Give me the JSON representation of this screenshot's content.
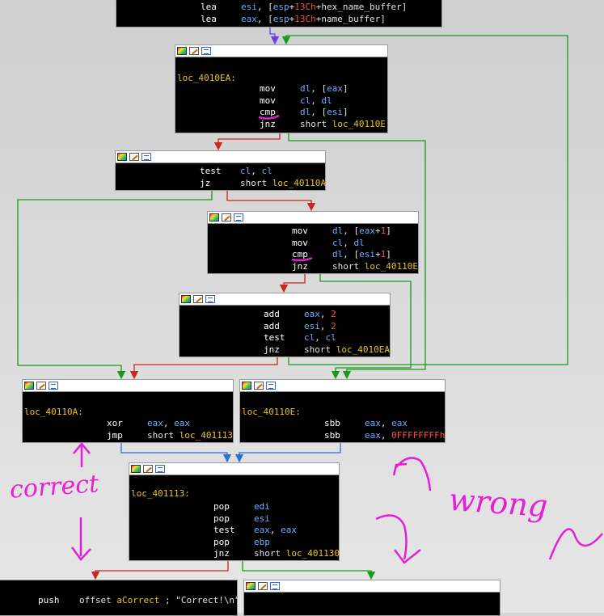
{
  "node0": {
    "lines": [
      {
        "mn": "lea",
        "ops": [
          {
            "t": "esi",
            "c": "reg"
          },
          {
            "t": ", [",
            "c": "tx"
          },
          {
            "t": "esp",
            "c": "reg"
          },
          {
            "t": "+",
            "c": "tx"
          },
          {
            "t": "13Ch",
            "c": "num"
          },
          {
            "t": "+hex_name_buffer]",
            "c": "tx"
          }
        ]
      },
      {
        "mn": "lea",
        "ops": [
          {
            "t": "eax",
            "c": "reg"
          },
          {
            "t": ", [",
            "c": "tx"
          },
          {
            "t": "esp",
            "c": "reg"
          },
          {
            "t": "+",
            "c": "tx"
          },
          {
            "t": "13Ch",
            "c": "num"
          },
          {
            "t": "+name_buffer]",
            "c": "tx"
          }
        ]
      }
    ]
  },
  "node1": {
    "label": "loc_4010EA:",
    "lines": [
      {
        "mn": "mov",
        "ops": [
          {
            "t": "dl",
            "c": "reg"
          },
          {
            "t": ", [",
            "c": "tx"
          },
          {
            "t": "eax",
            "c": "reg"
          },
          {
            "t": "]",
            "c": "tx"
          }
        ]
      },
      {
        "mn": "mov",
        "ops": [
          {
            "t": "cl",
            "c": "reg"
          },
          {
            "t": ", ",
            "c": "tx"
          },
          {
            "t": "dl",
            "c": "reg"
          }
        ]
      },
      {
        "mn": "cmp",
        "ops": [
          {
            "t": "dl",
            "c": "reg"
          },
          {
            "t": ", [",
            "c": "tx"
          },
          {
            "t": "esi",
            "c": "reg"
          },
          {
            "t": "]",
            "c": "tx"
          }
        ]
      },
      {
        "mn": "jnz",
        "ops": [
          {
            "t": "short ",
            "c": "tx"
          },
          {
            "t": "loc_40110E",
            "c": "sym"
          }
        ]
      }
    ]
  },
  "node2": {
    "lines": [
      {
        "mn": "test",
        "ops": [
          {
            "t": "cl",
            "c": "reg"
          },
          {
            "t": ", ",
            "c": "tx"
          },
          {
            "t": "cl",
            "c": "reg"
          }
        ]
      },
      {
        "mn": "jz",
        "ops": [
          {
            "t": "short ",
            "c": "tx"
          },
          {
            "t": "loc_40110A",
            "c": "sym"
          }
        ]
      }
    ]
  },
  "node3": {
    "lines": [
      {
        "mn": "mov",
        "ops": [
          {
            "t": "dl",
            "c": "reg"
          },
          {
            "t": ", [",
            "c": "tx"
          },
          {
            "t": "eax",
            "c": "reg"
          },
          {
            "t": "+",
            "c": "tx"
          },
          {
            "t": "1",
            "c": "num"
          },
          {
            "t": "]",
            "c": "tx"
          }
        ]
      },
      {
        "mn": "mov",
        "ops": [
          {
            "t": "cl",
            "c": "reg"
          },
          {
            "t": ", ",
            "c": "tx"
          },
          {
            "t": "dl",
            "c": "reg"
          }
        ]
      },
      {
        "mn": "cmp",
        "ops": [
          {
            "t": "dl",
            "c": "reg"
          },
          {
            "t": ", [",
            "c": "tx"
          },
          {
            "t": "esi",
            "c": "reg"
          },
          {
            "t": "+",
            "c": "tx"
          },
          {
            "t": "1",
            "c": "num"
          },
          {
            "t": "]",
            "c": "tx"
          }
        ]
      },
      {
        "mn": "jnz",
        "ops": [
          {
            "t": "short ",
            "c": "tx"
          },
          {
            "t": "loc_40110E",
            "c": "sym"
          }
        ]
      }
    ]
  },
  "node4": {
    "lines": [
      {
        "mn": "add",
        "ops": [
          {
            "t": "eax",
            "c": "reg"
          },
          {
            "t": ", ",
            "c": "tx"
          },
          {
            "t": "2",
            "c": "num"
          }
        ]
      },
      {
        "mn": "add",
        "ops": [
          {
            "t": "esi",
            "c": "reg"
          },
          {
            "t": ", ",
            "c": "tx"
          },
          {
            "t": "2",
            "c": "num"
          }
        ]
      },
      {
        "mn": "test",
        "ops": [
          {
            "t": "cl",
            "c": "reg"
          },
          {
            "t": ", ",
            "c": "tx"
          },
          {
            "t": "cl",
            "c": "reg"
          }
        ]
      },
      {
        "mn": "jnz",
        "ops": [
          {
            "t": "short ",
            "c": "tx"
          },
          {
            "t": "loc_4010EA",
            "c": "sym"
          }
        ]
      }
    ]
  },
  "node5": {
    "label": "loc_40110A:",
    "lines": [
      {
        "mn": "xor",
        "ops": [
          {
            "t": "eax",
            "c": "reg"
          },
          {
            "t": ", ",
            "c": "tx"
          },
          {
            "t": "eax",
            "c": "reg"
          }
        ]
      },
      {
        "mn": "jmp",
        "ops": [
          {
            "t": "short ",
            "c": "tx"
          },
          {
            "t": "loc_401113",
            "c": "sym"
          }
        ]
      }
    ]
  },
  "node6": {
    "label": "loc_40110E:",
    "lines": [
      {
        "mn": "sbb",
        "ops": [
          {
            "t": "eax",
            "c": "reg"
          },
          {
            "t": ", ",
            "c": "tx"
          },
          {
            "t": "eax",
            "c": "reg"
          }
        ]
      },
      {
        "mn": "sbb",
        "ops": [
          {
            "t": "eax",
            "c": "reg"
          },
          {
            "t": ", ",
            "c": "tx"
          },
          {
            "t": "0FFFFFFFFh",
            "c": "num"
          }
        ]
      }
    ]
  },
  "node7": {
    "label": "loc_401113:",
    "lines": [
      {
        "mn": "pop",
        "ops": [
          {
            "t": "edi",
            "c": "reg"
          }
        ]
      },
      {
        "mn": "pop",
        "ops": [
          {
            "t": "esi",
            "c": "reg"
          }
        ]
      },
      {
        "mn": "test",
        "ops": [
          {
            "t": "eax",
            "c": "reg"
          },
          {
            "t": ", ",
            "c": "tx"
          },
          {
            "t": "eax",
            "c": "reg"
          }
        ]
      },
      {
        "mn": "pop",
        "ops": [
          {
            "t": "ebp",
            "c": "reg"
          }
        ]
      },
      {
        "mn": "jnz",
        "ops": [
          {
            "t": "short ",
            "c": "tx"
          },
          {
            "t": "loc_401130",
            "c": "sym"
          }
        ]
      }
    ]
  },
  "node8": {
    "lines": [
      {
        "mn": "push",
        "ops": [
          {
            "t": "offset ",
            "c": "tx"
          },
          {
            "t": "aCorrect",
            "c": "sym"
          },
          {
            "t": " ; \"Correct!\\n\"",
            "c": "cm"
          }
        ]
      }
    ]
  },
  "annotations": {
    "correct": "correct",
    "wrong": "wrong"
  },
  "colors": {
    "true_edge": "#1a9a1a",
    "false_edge": "#c8281e",
    "uncond_edge": "#2f6fd6",
    "back_edge": "#1a9a1a",
    "entry_edge": "#6a3df0",
    "annotation": "#e41fd4"
  }
}
